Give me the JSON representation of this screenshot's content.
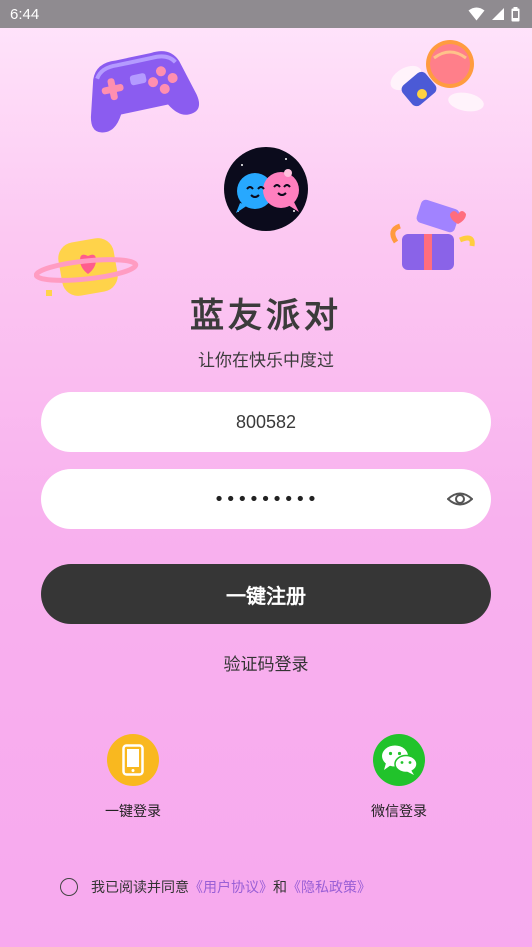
{
  "status_bar": {
    "time": "6:44"
  },
  "app": {
    "title": "蓝友派对",
    "subtitle": "让你在快乐中度过"
  },
  "form": {
    "phone_value": "800582",
    "password_mask": "•••••••••"
  },
  "buttons": {
    "register": "一键注册",
    "code_login": "验证码登录",
    "one_click_login": "一键登录",
    "wechat_login": "微信登录"
  },
  "agreement": {
    "prefix": "我已阅读并同意",
    "user_agreement": "《用户协议》",
    "and": "和",
    "privacy_policy": "《隐私政策》"
  },
  "colors": {
    "primary_button": "#363636",
    "link": "#9a5fd6",
    "phone_icon_bg": "#f9b81f",
    "wechat_icon_bg": "#21c32b"
  },
  "icons": [
    "wifi-icon",
    "signal-icon",
    "battery-icon",
    "gamepad-icon",
    "microphone-icon",
    "heart-planet-icon",
    "gift-box-icon",
    "eye-icon",
    "phone-icon",
    "wechat-icon"
  ]
}
